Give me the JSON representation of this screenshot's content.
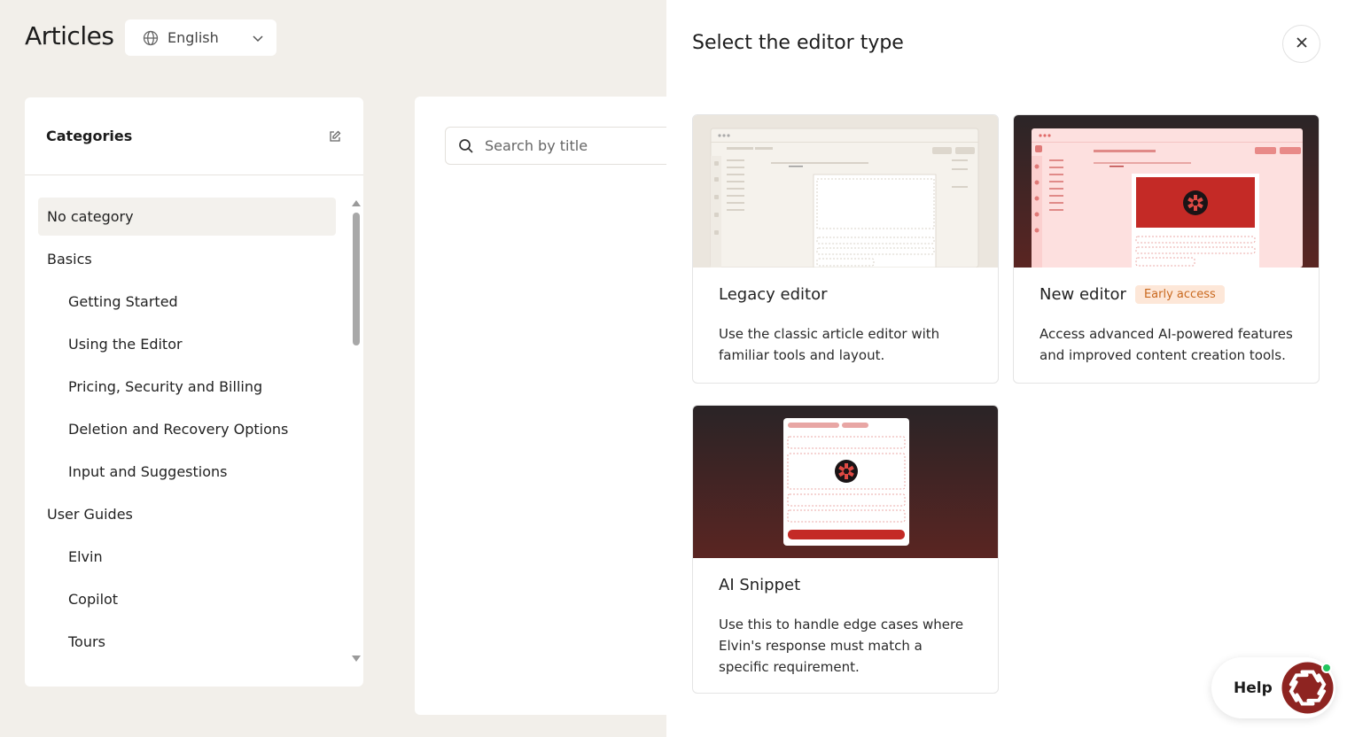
{
  "page": {
    "title": "Articles"
  },
  "language_select": {
    "value": "English"
  },
  "categories": {
    "title": "Categories",
    "items": [
      {
        "label": "No category",
        "level": 0,
        "active": true
      },
      {
        "label": "Basics",
        "level": 0
      },
      {
        "label": "Getting Started",
        "level": 1
      },
      {
        "label": "Using the Editor",
        "level": 1
      },
      {
        "label": "Pricing, Security and Billing",
        "level": 1
      },
      {
        "label": "Deletion and Recovery Options",
        "level": 1
      },
      {
        "label": "Input and Suggestions",
        "level": 1
      },
      {
        "label": "User Guides",
        "level": 0
      },
      {
        "label": "Elvin",
        "level": 1
      },
      {
        "label": "Copilot",
        "level": 1
      },
      {
        "label": "Tours",
        "level": 1
      }
    ]
  },
  "search": {
    "placeholder": "Search by title"
  },
  "drawer": {
    "title": "Select the editor type",
    "cards": {
      "legacy": {
        "name": "Legacy editor",
        "description": "Use the classic article editor with familiar tools and layout."
      },
      "new": {
        "name": "New editor",
        "badge": "Early access",
        "description": "Access advanced AI-powered features and improved content creation tools."
      },
      "snippet": {
        "name": "AI Snippet",
        "description": "Use this to handle edge cases where Elvin's response must match a specific requirement."
      }
    }
  },
  "help": {
    "label": "Help",
    "status_color": "#22c55e"
  },
  "colors": {
    "accent_red": "#c42a26",
    "badge_bg": "#fde7d8",
    "badge_text": "#c9691f",
    "page_bg": "#f2efea"
  }
}
